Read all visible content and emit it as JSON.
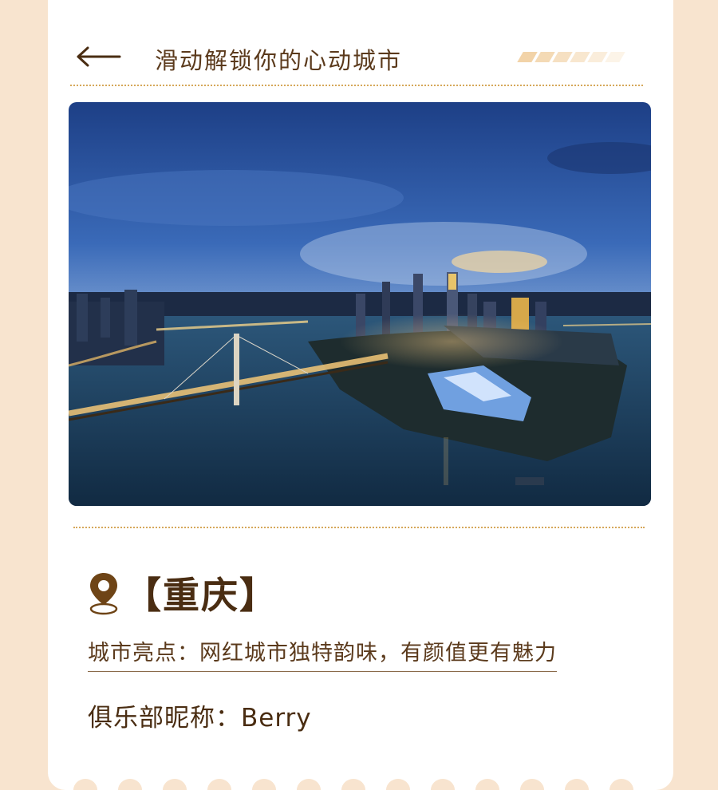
{
  "header": {
    "back_icon": "left-arrow-icon",
    "title": "滑动解锁你的心动城市",
    "stripe_colors": [
      "#f2d3a8",
      "#f4dab5",
      "#f6e0c2",
      "#f8e7cf",
      "#faeddb",
      "#fcf4e8"
    ]
  },
  "photo": {
    "description_icon": "chongqing-night-skyline-image"
  },
  "city": {
    "pin_icon": "location-pin-icon",
    "name": "【重庆】"
  },
  "highlight": "城市亮点：网红城市独特韵味，有颜值更有魅力",
  "nickname": "俱乐部昵称：Berry",
  "colors": {
    "background": "#f8e4cf",
    "text_dark": "#4a2d12",
    "text_brown": "#5b3a1c",
    "dotted_line": "#d6a85a"
  }
}
